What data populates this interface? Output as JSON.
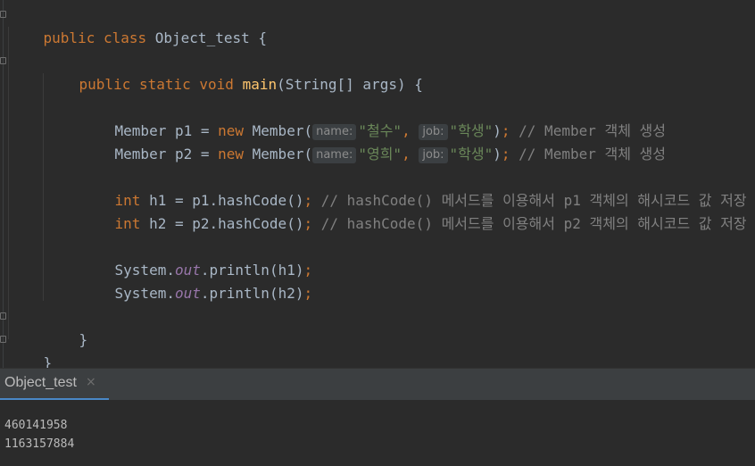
{
  "code": {
    "line1": {
      "kw": "public class ",
      "name": "Object_test ",
      "brace": "{"
    },
    "line2": {
      "kw1": "public static void ",
      "fn": "main",
      "rest": "(String[] args) {"
    },
    "line3": {
      "decl": "Member p1 = ",
      "kw": "new ",
      "cls": "Member(",
      "hint_name": "name:",
      "arg1": "\"철수\"",
      "comma": ", ",
      "hint_job": "job:",
      "arg2": "\"학생\"",
      "close": ")",
      "semi": "; ",
      "comment": "// Member 객체 생성"
    },
    "line4": {
      "decl": "Member p2 = ",
      "kw": "new ",
      "cls": "Member(",
      "hint_name": "name:",
      "arg1": "\"영희\"",
      "comma": ", ",
      "hint_job": "job:",
      "arg2": "\"학생\"",
      "close": ")",
      "semi": "; ",
      "comment": "// Member 객체 생성"
    },
    "line5": {
      "kw": "int ",
      "rest": "h1 = p1.hashCode()",
      "semi": "; ",
      "comment": "// hashCode() 메서드를 이용해서 p1 객체의 해시코드 값 저장"
    },
    "line6": {
      "kw": "int ",
      "rest": "h2 = p2.hashCode()",
      "semi": "; ",
      "comment": "// hashCode() 메서드를 이용해서 p2 객체의 해시코드 값 저장"
    },
    "line7": {
      "pre": "System.",
      "field": "out",
      "post": ".println(h1)",
      "semi": ";"
    },
    "line8": {
      "pre": "System.",
      "field": "out",
      "post": ".println(h2)",
      "semi": ";"
    },
    "line9": {
      "brace": "}"
    },
    "line10": {
      "brace": "}"
    }
  },
  "run_panel": {
    "tab_label": "Object_test",
    "close_icon": "×",
    "output": [
      "460141958",
      "1163157884"
    ]
  },
  "colors": {
    "background": "#2b2b2b",
    "keyword": "#cc7832",
    "method": "#ffc66d",
    "string": "#6a8759",
    "comment": "#808080",
    "field": "#9876aa",
    "tab_underline": "#4a88c7"
  }
}
